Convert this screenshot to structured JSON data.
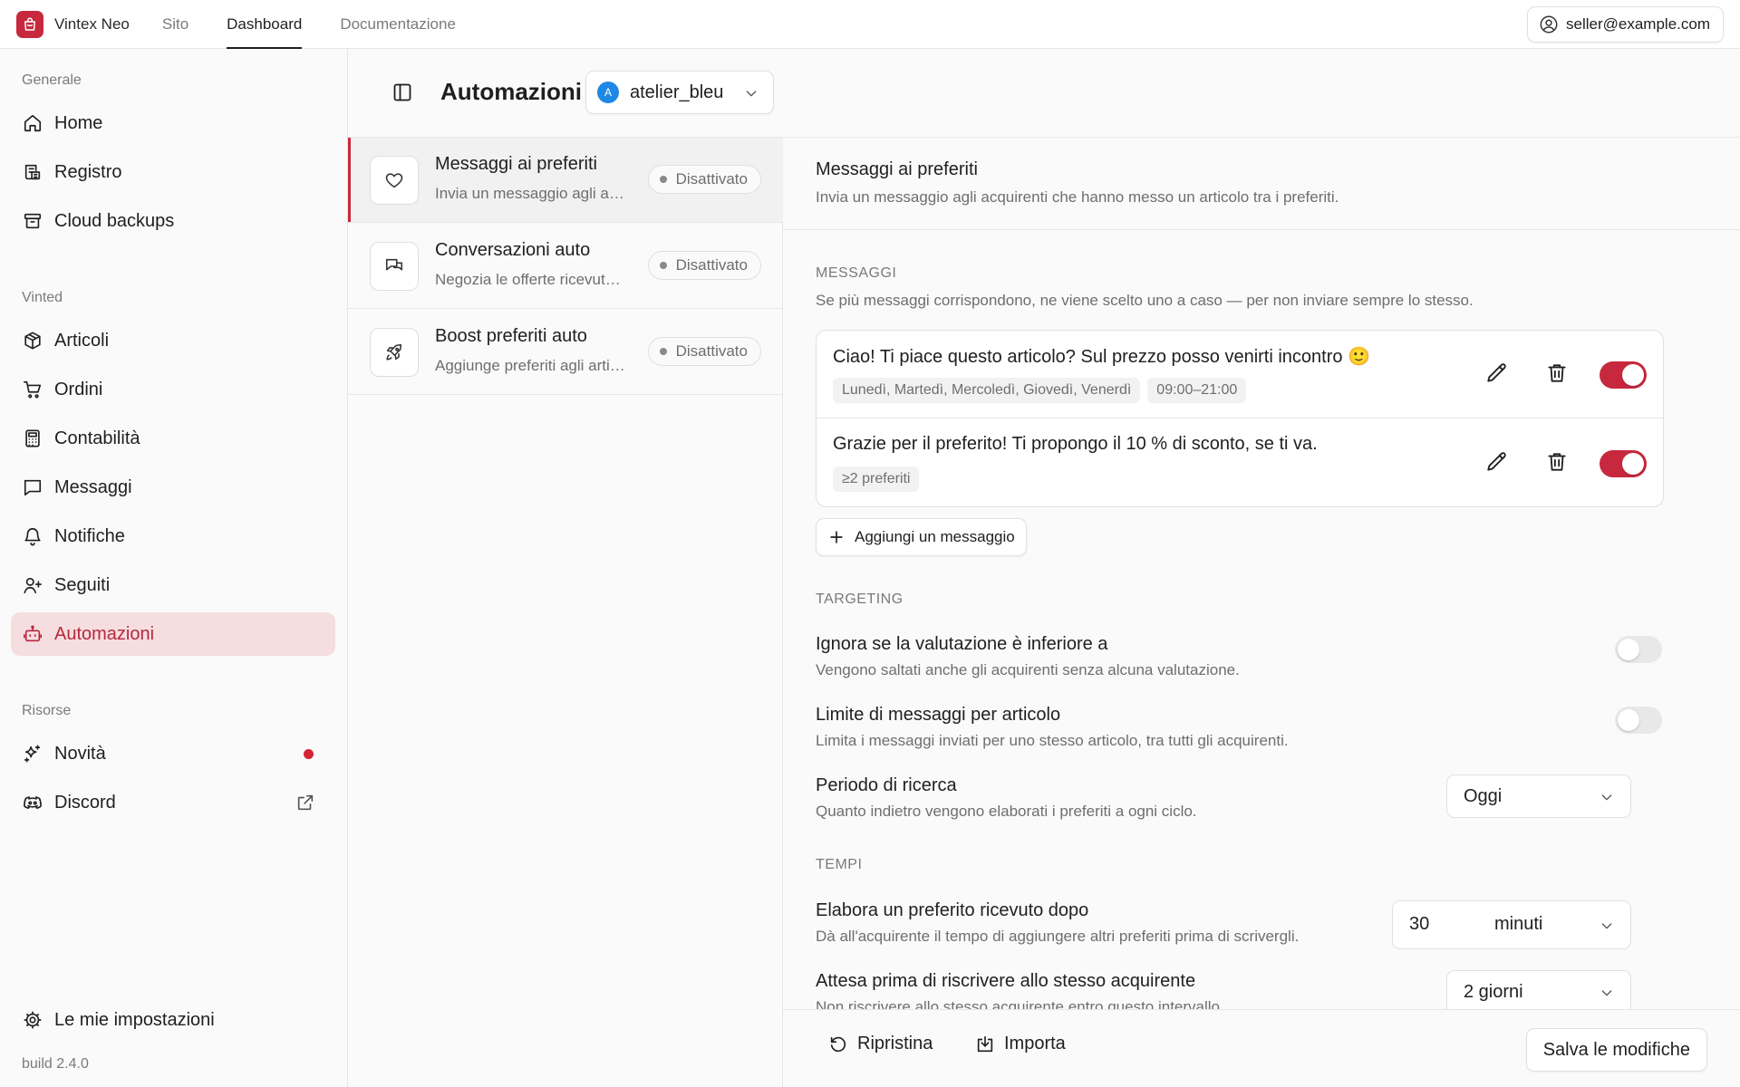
{
  "brand": {
    "name": "Vintex Neo",
    "logo_icon": "bag-icon",
    "accent": "#c8283d"
  },
  "topnav": [
    {
      "label": "Sito",
      "active": false
    },
    {
      "label": "Dashboard",
      "active": true
    },
    {
      "label": "Documentazione",
      "active": false
    }
  ],
  "user": {
    "email": "seller@example.com",
    "icon": "user-circle-icon"
  },
  "sidebar": {
    "sections": {
      "generale": "Generale",
      "vinted": "Vinted",
      "risorse": "Risorse"
    },
    "generale_items": [
      {
        "label": "Home",
        "icon": "home-icon"
      },
      {
        "label": "Registro",
        "icon": "log-icon"
      },
      {
        "label": "Cloud backups",
        "icon": "archive-icon"
      }
    ],
    "vinted_items": [
      {
        "label": "Articoli",
        "icon": "box-icon"
      },
      {
        "label": "Ordini",
        "icon": "cart-icon"
      },
      {
        "label": "Contabilità",
        "icon": "calculator-icon"
      },
      {
        "label": "Messaggi",
        "icon": "message-icon"
      },
      {
        "label": "Notifiche",
        "icon": "bell-icon"
      },
      {
        "label": "Seguiti",
        "icon": "user-plus-icon"
      },
      {
        "label": "Automazioni",
        "icon": "robot-icon",
        "active": true
      }
    ],
    "risorse_items": [
      {
        "label": "Novità",
        "icon": "sparkles-icon",
        "has_dot": true
      },
      {
        "label": "Discord",
        "icon": "discord-icon",
        "external": true
      }
    ],
    "settings_label": "Le mie impostazioni",
    "build": "build 2.4.0"
  },
  "header": {
    "title": "Automazioni",
    "account": {
      "initial": "A",
      "name": "atelier_bleu"
    }
  },
  "automations": [
    {
      "title": "Messaggi ai preferiti",
      "desc": "Invia un messaggio agli acquirenti che hanno messo un articolo tra i preferiti.",
      "status": "Disattivato",
      "icon": "heart-icon",
      "active": true
    },
    {
      "title": "Conversazioni auto",
      "desc": "Negozia le offerte ricevute automaticamente.",
      "status": "Disattivato",
      "icon": "chat-icon",
      "active": false
    },
    {
      "title": "Boost preferiti auto",
      "desc": "Aggiunge preferiti agli articoli automaticamente.",
      "status": "Disattivato",
      "icon": "rocket-icon",
      "active": false
    }
  ],
  "detail": {
    "title": "Messaggi ai preferiti",
    "desc": "Invia un messaggio agli acquirenti che hanno messo un articolo tra i preferiti.",
    "messages_section": {
      "label": "MESSAGGI",
      "desc": "Se più messaggi corrispondono, ne viene scelto uno a caso — per non inviare sempre lo stesso."
    },
    "messages": [
      {
        "text": "Ciao! Ti piace questo articolo? Sul prezzo posso venirti incontro 🙂",
        "chips": [
          "Lunedì, Martedì, Mercoledì, Giovedì, Venerdì",
          "09:00–21:00"
        ],
        "enabled": true
      },
      {
        "text": "Grazie per il preferito! Ti propongo il 10 % di sconto, se ti va.",
        "chips": [
          "≥2 preferiti"
        ],
        "enabled": true
      }
    ],
    "add_message_label": "Aggiungi un messaggio",
    "targeting": {
      "label": "TARGETING",
      "rating": {
        "title": "Ignora se la valutazione è inferiore a",
        "desc": "Vengono saltati anche gli acquirenti senza alcuna valutazione.",
        "enabled": false
      },
      "limit": {
        "title": "Limite di messaggi per articolo",
        "desc": "Limita i messaggi inviati per uno stesso articolo, tra tutti gli acquirenti.",
        "enabled": false
      },
      "period": {
        "title": "Periodo di ricerca",
        "desc": "Quanto indietro vengono elaborati i preferiti a ogni ciclo.",
        "value": "Oggi"
      }
    },
    "timing": {
      "label": "TEMPI",
      "delay": {
        "title": "Elabora un preferito ricevuto dopo",
        "desc": "Dà all'acquirente il tempo di aggiungere altri preferiti prima di scrivergli.",
        "value": "30",
        "unit": "minuti"
      },
      "wait": {
        "title": "Attesa prima di riscrivere allo stesso acquirente",
        "desc": "Non riscrivere allo stesso acquirente entro questo intervallo.",
        "value": "2 giorni"
      }
    }
  },
  "footer": {
    "reset_label": "Ripristina",
    "import_label": "Importa",
    "save_label": "Salva le modifiche"
  }
}
